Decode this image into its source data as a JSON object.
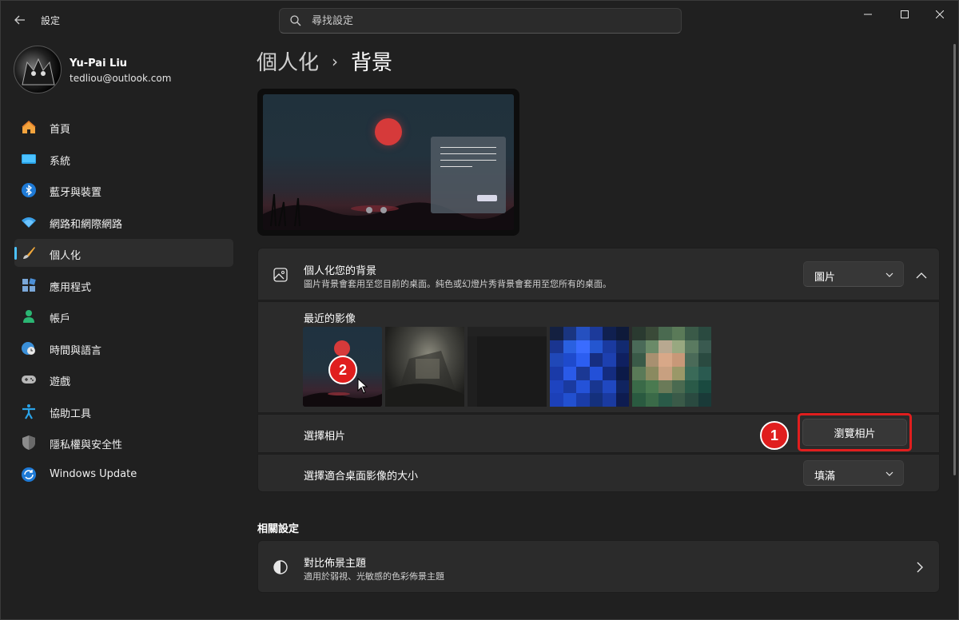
{
  "window": {
    "app_title": "設定",
    "back_icon": "back-arrow-icon",
    "controls": [
      "minimize",
      "maximize",
      "close"
    ]
  },
  "search": {
    "placeholder": "尋找設定"
  },
  "profile": {
    "name": "Yu-Pai Liu",
    "email": "tedliou@outlook.com"
  },
  "sidebar": {
    "items": [
      {
        "label": "首頁",
        "icon": "home-icon"
      },
      {
        "label": "系統",
        "icon": "monitor-icon"
      },
      {
        "label": "藍牙與裝置",
        "icon": "bluetooth-icon"
      },
      {
        "label": "網路和網際網路",
        "icon": "wifi-icon"
      },
      {
        "label": "個人化",
        "icon": "paintbrush-icon",
        "active": true
      },
      {
        "label": "應用程式",
        "icon": "apps-icon"
      },
      {
        "label": "帳戶",
        "icon": "person-icon"
      },
      {
        "label": "時間與語言",
        "icon": "globe-clock-icon"
      },
      {
        "label": "遊戲",
        "icon": "gamepad-icon"
      },
      {
        "label": "協助工具",
        "icon": "accessibility-icon"
      },
      {
        "label": "隱私權與安全性",
        "icon": "shield-icon"
      },
      {
        "label": "Windows Update",
        "icon": "update-icon"
      }
    ],
    "accent": "#4cc2ff"
  },
  "breadcrumb": {
    "parent": "個人化",
    "separator": "›",
    "current": "背景"
  },
  "background_card": {
    "title": "個人化您的背景",
    "description": "圖片背景會套用至您目前的桌面。純色或幻燈片秀背景會套用至您所有的桌面。",
    "type_value": "圖片",
    "recent_title": "最近的影像",
    "choose_photo_label": "選擇相片",
    "browse_button": "瀏覽相片",
    "fit_label": "選擇適合桌面影像的大小",
    "fit_value": "填滿"
  },
  "annotations": {
    "badge_1": "1",
    "badge_2": "2",
    "color": "#e01e1e"
  },
  "related": {
    "section_title": "相關設定",
    "contrast_title": "對比佈景主題",
    "contrast_desc": "適用於弱視、光敏感的色彩佈景主題"
  }
}
